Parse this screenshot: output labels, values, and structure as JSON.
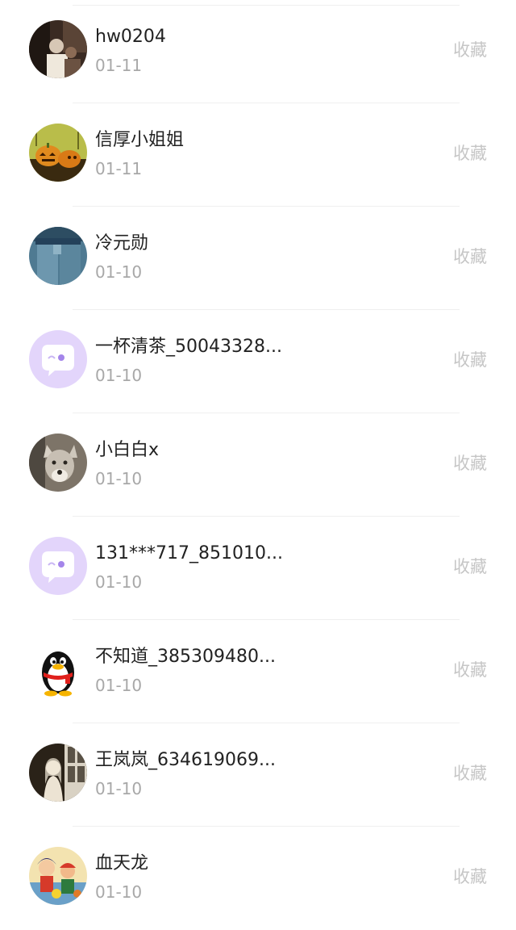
{
  "rows": [
    {
      "name": "hw0204",
      "date": "01-11",
      "action": "收藏",
      "avatar": "photo-dark-avatar"
    },
    {
      "name": "信厚小姐姐",
      "date": "01-11",
      "action": "收藏",
      "avatar": "pumpkin-avatar"
    },
    {
      "name": "冷元勋",
      "date": "01-10",
      "action": "收藏",
      "avatar": "jeans-avatar"
    },
    {
      "name": "一杯清茶_50043328...",
      "date": "01-10",
      "action": "收藏",
      "avatar": "default-chat-avatar"
    },
    {
      "name": "小白白x",
      "date": "01-10",
      "action": "收藏",
      "avatar": "wolf-avatar"
    },
    {
      "name": "131***717_851010...",
      "date": "01-10",
      "action": "收藏",
      "avatar": "default-chat-avatar"
    },
    {
      "name": "不知道_385309480...",
      "date": "01-10",
      "action": "收藏",
      "avatar": "penguin-avatar"
    },
    {
      "name": "王岚岚_634619069...",
      "date": "01-10",
      "action": "收藏",
      "avatar": "girl-window-avatar"
    },
    {
      "name": "血天龙",
      "date": "01-10",
      "action": "收藏",
      "avatar": "cartoon-avatar"
    }
  ],
  "colors": {
    "name_text": "#222222",
    "date_text": "#a8a8a8",
    "action_text": "#c6c6c6",
    "default_avatar_bg": "#e3d5fb",
    "default_avatar_accent": "#b59cf0"
  }
}
